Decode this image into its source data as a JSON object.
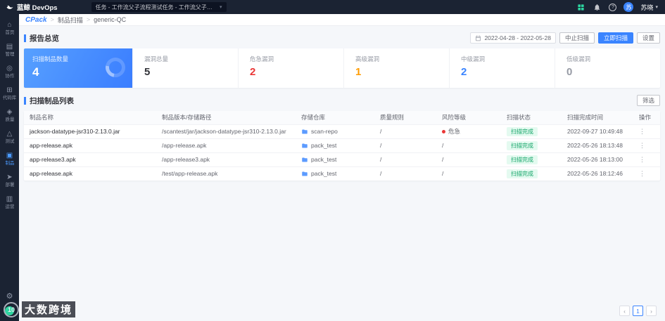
{
  "topbar": {
    "logo": "蓝鲸 DevOps",
    "task_selector": "任务 - 工作流父子流程测试任务 - 工作流父子流程演...",
    "caret": "▾",
    "help": "?",
    "user": {
      "avatar_text": "苏",
      "name": "苏晓"
    }
  },
  "sidebar": {
    "items": [
      {
        "label": "首页",
        "glyph": "⌂"
      },
      {
        "label": "管理",
        "glyph": "▤"
      },
      {
        "label": "协作",
        "glyph": "◎"
      },
      {
        "label": "代码库",
        "glyph": "⊞"
      },
      {
        "label": "质量",
        "glyph": "◈"
      },
      {
        "label": "测试",
        "glyph": "△"
      },
      {
        "label": "制品",
        "glyph": "▣"
      },
      {
        "label": "部署",
        "glyph": "➤"
      },
      {
        "label": "运营",
        "glyph": "▥"
      }
    ],
    "gear_glyph": "⚙"
  },
  "breadcrumb": {
    "app": "CPack",
    "sep": "&gt;",
    "items": [
      "制品扫描",
      "generic-QC"
    ]
  },
  "overview": {
    "title": "报告总览",
    "date_range": "2022-04-28 - 2022-05-28",
    "buttons": {
      "stop": "中止扫描",
      "scan": "立即扫描",
      "settings": "设置"
    },
    "cards": [
      {
        "label": "扫描制品数量",
        "value": "4",
        "color": "#ffffff"
      },
      {
        "label": "漏洞总量",
        "value": "5",
        "color": "#313238"
      },
      {
        "label": "危急漏洞",
        "value": "2",
        "color": "#ea3636"
      },
      {
        "label": "高级漏洞",
        "value": "1",
        "color": "#ff9c01"
      },
      {
        "label": "中级漏洞",
        "value": "2",
        "color": "#3a84ff"
      },
      {
        "label": "低级漏洞",
        "value": "0",
        "color": "#979ba5"
      }
    ]
  },
  "list": {
    "title": "扫描制品列表",
    "filter_button": "筛选",
    "columns": [
      "制品名称",
      "制品版本/存储路径",
      "存储仓库",
      "质量规则",
      "风险等级",
      "扫描状态",
      "扫描完成时间",
      "操作"
    ],
    "row_action_icon": "⋮",
    "rows": [
      {
        "name": "jackson-datatype-jsr310-2.13.0.jar",
        "path": "/scantest/jar/jackson-datatype-jsr310-2.13.0.jar",
        "repo": "scan-repo",
        "rule": "/",
        "risk": "危急",
        "risk_color": "#ea3636",
        "status": "扫描完成",
        "time": "2022-09-27 10:49:48"
      },
      {
        "name": "app-release.apk",
        "path": "/app-release.apk",
        "repo": "pack_test",
        "rule": "/",
        "risk": "/",
        "status": "扫描完成",
        "time": "2022-05-26 18:13:48"
      },
      {
        "name": "app-release3.apk",
        "path": "/app-release3.apk",
        "repo": "pack_test",
        "rule": "/",
        "risk": "/",
        "status": "扫描完成",
        "time": "2022-05-26 18:13:00"
      },
      {
        "name": "app-release.apk",
        "path": "/test/app-release.apk",
        "repo": "pack_test",
        "rule": "/",
        "risk": "/",
        "status": "扫描完成",
        "time": "2022-05-26 18:12:46"
      }
    ]
  },
  "pagination": {
    "prev": "‹",
    "page": "1",
    "next": "›"
  },
  "watermark": {
    "logo_text": "10",
    "text": "大数跨境"
  },
  "colors": {
    "accent": "#3a84ff",
    "success": "#14a568",
    "danger": "#ea3636",
    "warning": "#ff9c01",
    "topbar_bg": "#1b2333"
  }
}
